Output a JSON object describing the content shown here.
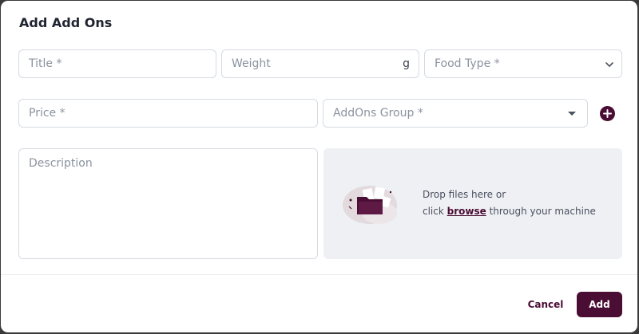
{
  "modal": {
    "title": "Add Add Ons"
  },
  "form": {
    "title_placeholder": "Title *",
    "weight_placeholder": "Weight",
    "weight_unit": "g",
    "food_type_placeholder": "Food Type *",
    "price_placeholder": "Price *",
    "addons_group_placeholder": "AddOns Group *",
    "description_placeholder": "Description"
  },
  "dropzone": {
    "line1": "Drop files here or",
    "line2_prefix": "click ",
    "browse_label": "browse",
    "line2_suffix": " through your machine"
  },
  "footer": {
    "cancel_label": "Cancel",
    "add_label": "Add"
  },
  "colors": {
    "accent": "#4a0d33",
    "field_border": "#d6dae1",
    "dropzone_bg": "#eef0f3"
  },
  "icons": {
    "food_type_chevron": "chevron-down-icon",
    "addons_group_caret": "caret-down-icon",
    "add_group": "plus-circle-icon",
    "upload_illustration": "folder-upload-illustration"
  }
}
